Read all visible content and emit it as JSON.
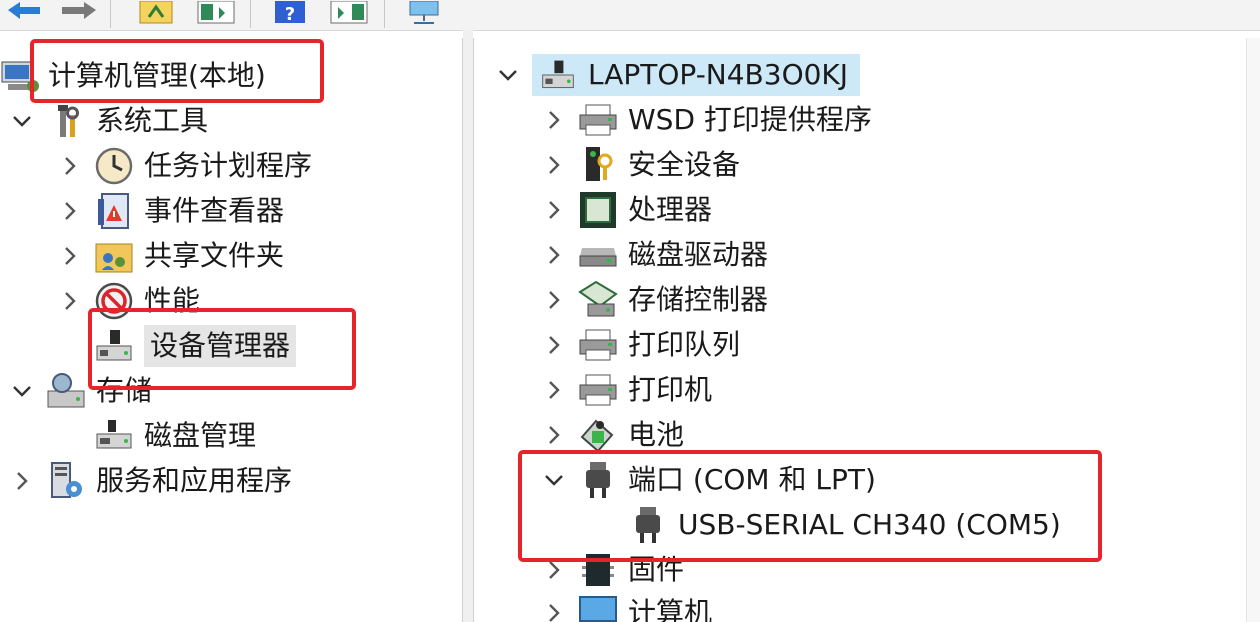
{
  "left_tree": {
    "root": "计算机管理(本地)",
    "system_tools": "系统工具",
    "task_scheduler": "任务计划程序",
    "event_viewer": "事件查看器",
    "shared_folders": "共享文件夹",
    "performance": "性能",
    "device_manager": "设备管理器",
    "storage": "存储",
    "disk_management": "磁盘管理",
    "services_apps": "服务和应用程序"
  },
  "right_tree": {
    "computer_name": "LAPTOP-N4B3O0KJ",
    "items": [
      "WSD 打印提供程序",
      "安全设备",
      "处理器",
      "磁盘驱动器",
      "存储控制器",
      "打印队列",
      "打印机",
      "电池",
      "端口 (COM 和 LPT)",
      "USB-SERIAL CH340 (COM5)",
      "固件",
      "计算机"
    ]
  },
  "colors": {
    "highlight": "#e5252a",
    "selection": "#cde8f7"
  }
}
